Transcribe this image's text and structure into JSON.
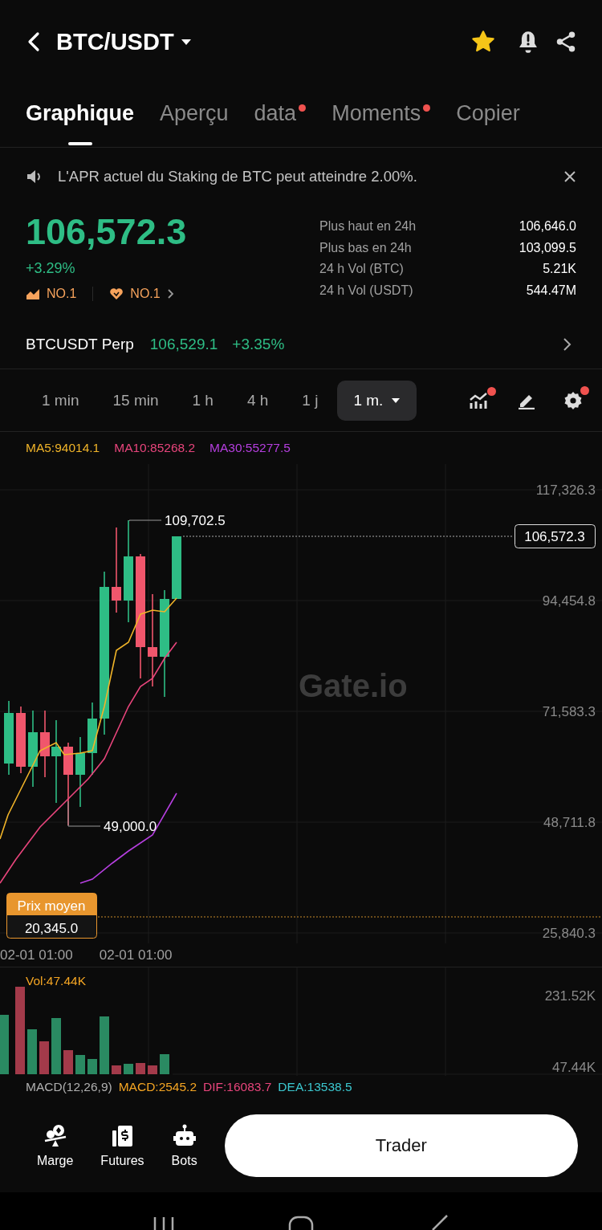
{
  "header": {
    "title": "BTC/USDT",
    "favorite": true
  },
  "tabs": [
    {
      "label": "Graphique",
      "selected": true,
      "badge": false
    },
    {
      "label": "Aperçu",
      "selected": false,
      "badge": false
    },
    {
      "label": "data",
      "selected": false,
      "badge": true
    },
    {
      "label": "Moments",
      "selected": false,
      "badge": true
    },
    {
      "label": "Copier",
      "selected": false,
      "badge": false
    }
  ],
  "announcement": {
    "text": "L'APR actuel du Staking de BTC peut atteindre 2.00%."
  },
  "ticker": {
    "price": "106,572.3",
    "change": "+3.29%",
    "ranks": [
      {
        "kind": "trend",
        "label": "NO.1"
      },
      {
        "kind": "heart",
        "label": "NO.1"
      }
    ],
    "stats": [
      {
        "label": "Plus haut en 24h",
        "value": "106,646.0"
      },
      {
        "label": "Plus bas en 24h",
        "value": "103,099.5"
      },
      {
        "label": "24 h Vol (BTC)",
        "value": "5.21K"
      },
      {
        "label": "24 h Vol (USDT)",
        "value": "544.47M"
      }
    ]
  },
  "perp": {
    "name": "BTCUSDT Perp",
    "price": "106,529.1",
    "change": "+3.35%"
  },
  "intervals": [
    {
      "label": "1 min",
      "selected": false
    },
    {
      "label": "15 min",
      "selected": false
    },
    {
      "label": "1 h",
      "selected": false
    },
    {
      "label": "4 h",
      "selected": false
    },
    {
      "label": "1 j",
      "selected": false
    },
    {
      "label": "1 m.",
      "selected": true
    }
  ],
  "chart_tools": [
    {
      "kind": "indicators",
      "badge": true
    },
    {
      "kind": "draw",
      "badge": false
    },
    {
      "kind": "settings",
      "badge": true
    }
  ],
  "moving_averages": [
    {
      "label": "MA5:94014.1",
      "color": "#f0b429"
    },
    {
      "label": "MA10:85268.2",
      "color": "#e8457c"
    },
    {
      "label": "MA30:55277.5",
      "color": "#b63fe0"
    }
  ],
  "price_chart": {
    "watermark": "Gate.io",
    "price_axis": [
      "117,326.3",
      "94,454.8",
      "71,583.3",
      "48,711.8",
      "25,840.3"
    ],
    "high_label": "109,702.5",
    "low_label": "49,000.0",
    "current_price": "106,572.3",
    "average_price": {
      "label": "Prix moyen",
      "value": "20,345.0"
    },
    "time_axis": [
      "02-01 01:00",
      "02-01 01:00"
    ]
  },
  "volume": {
    "label": "Vol:47.44K",
    "axis": [
      "231.52K",
      "47.44K"
    ]
  },
  "macd": [
    {
      "text": "MACD(12,26,9)",
      "color": "#b0b0b0"
    },
    {
      "text": "MACD:2545.2",
      "color": "#f5a623"
    },
    {
      "text": "DIF:16083.7",
      "color": "#e8457c"
    },
    {
      "text": "DEA:13538.5",
      "color": "#3cc8d0"
    }
  ],
  "bottom_bar": {
    "actions": [
      {
        "kind": "margin",
        "label": "Marge"
      },
      {
        "kind": "futures",
        "label": "Futures"
      },
      {
        "kind": "bots",
        "label": "Bots"
      }
    ],
    "trade_button": "Trader"
  }
}
